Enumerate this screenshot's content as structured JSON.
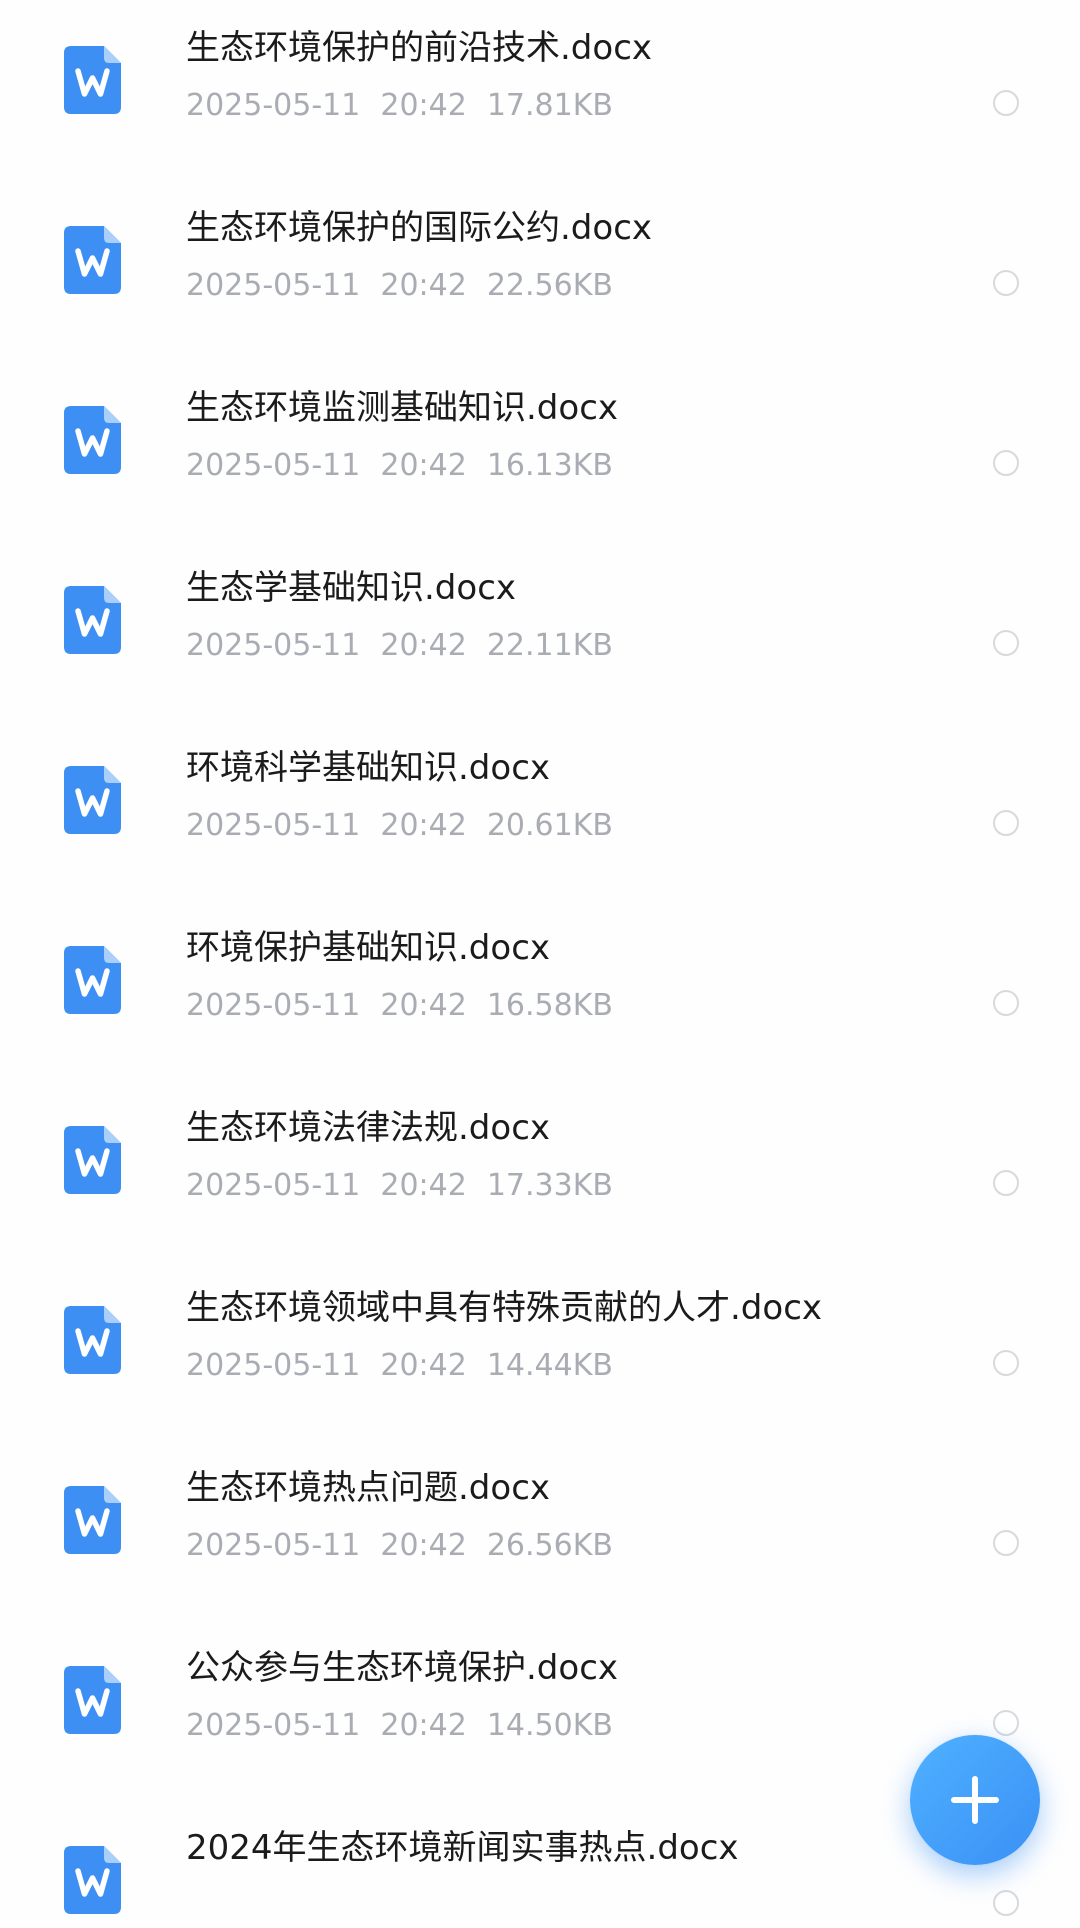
{
  "files": [
    {
      "name": "生态环境保护的前沿技术.docx",
      "date": "2025-05-11",
      "time": "20:42",
      "size": "17.81KB"
    },
    {
      "name": "生态环境保护的国际公约.docx",
      "date": "2025-05-11",
      "time": "20:42",
      "size": "22.56KB"
    },
    {
      "name": "生态环境监测基础知识.docx",
      "date": "2025-05-11",
      "time": "20:42",
      "size": "16.13KB"
    },
    {
      "name": "生态学基础知识.docx",
      "date": "2025-05-11",
      "time": "20:42",
      "size": "22.11KB"
    },
    {
      "name": "环境科学基础知识.docx",
      "date": "2025-05-11",
      "time": "20:42",
      "size": "20.61KB"
    },
    {
      "name": "环境保护基础知识.docx",
      "date": "2025-05-11",
      "time": "20:42",
      "size": "16.58KB"
    },
    {
      "name": "生态环境法律法规.docx",
      "date": "2025-05-11",
      "time": "20:42",
      "size": "17.33KB"
    },
    {
      "name": "生态环境领域中具有特殊贡献的人才.docx",
      "date": "2025-05-11",
      "time": "20:42",
      "size": "14.44KB"
    },
    {
      "name": "生态环境热点问题.docx",
      "date": "2025-05-11",
      "time": "20:42",
      "size": "26.56KB"
    },
    {
      "name": "公众参与生态环境保护.docx",
      "date": "2025-05-11",
      "time": "20:42",
      "size": "14.50KB"
    },
    {
      "name": "2024年生态环境新闻实事热点.docx",
      "date": "",
      "time": "",
      "size": ""
    }
  ],
  "file_icon": "word-document-icon",
  "fab_icon": "plus-icon",
  "colors": {
    "icon_blue": "#3d8ff3",
    "fab_blue": "#3f98f8",
    "meta_gray": "#a9adb3",
    "name_black": "#1b1b1b"
  }
}
